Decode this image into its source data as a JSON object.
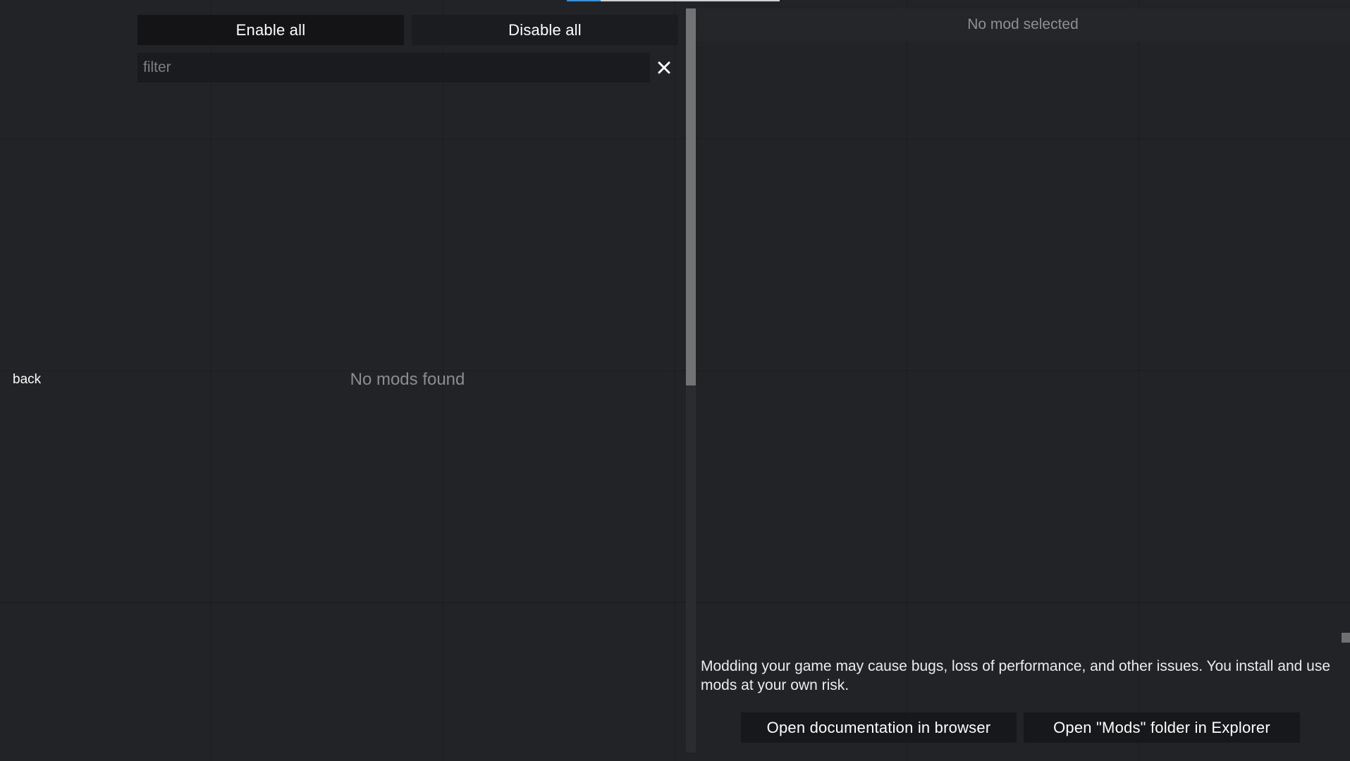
{
  "header": {
    "progress_percent": 16
  },
  "mod_list": {
    "enable_all_label": "Enable all",
    "disable_all_label": "Disable all",
    "filter": {
      "value": "",
      "placeholder": "filter"
    },
    "clear_icon": "close-icon",
    "empty_message": "No mods found"
  },
  "navigation": {
    "back_label": "back"
  },
  "detail": {
    "header_text": "No mod selected",
    "warning_text": "Modding your game may cause bugs, loss of performance, and other issues. You install and use mods at your own risk.",
    "open_docs_label": "Open documentation in browser",
    "open_folder_label": "Open \"Mods\" folder in Explorer"
  },
  "colors": {
    "background": "#222327",
    "button": "#141417",
    "accent": "#3b8fd3",
    "muted_text": "#8c8d90"
  }
}
